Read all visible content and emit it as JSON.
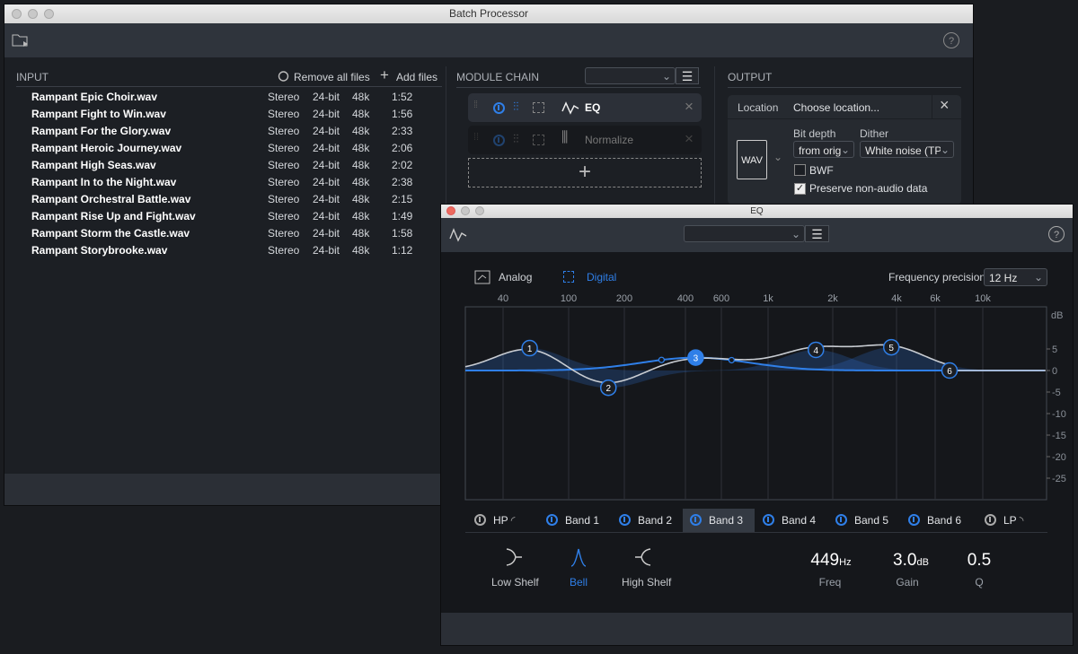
{
  "batch": {
    "title": "Batch Processor",
    "input_header": "INPUT",
    "remove_all_label": "Remove all files",
    "add_files_label": "Add files",
    "files": [
      {
        "name": "Rampant Epic Choir.wav",
        "channels": "Stereo",
        "bits": "24-bit",
        "rate": "48k",
        "duration": "1:52"
      },
      {
        "name": "Rampant Fight to Win.wav",
        "channels": "Stereo",
        "bits": "24-bit",
        "rate": "48k",
        "duration": "1:56"
      },
      {
        "name": "Rampant For the Glory.wav",
        "channels": "Stereo",
        "bits": "24-bit",
        "rate": "48k",
        "duration": "2:33"
      },
      {
        "name": "Rampant Heroic Journey.wav",
        "channels": "Stereo",
        "bits": "24-bit",
        "rate": "48k",
        "duration": "2:06"
      },
      {
        "name": "Rampant High Seas.wav",
        "channels": "Stereo",
        "bits": "24-bit",
        "rate": "48k",
        "duration": "2:02"
      },
      {
        "name": "Rampant In to the Night.wav",
        "channels": "Stereo",
        "bits": "24-bit",
        "rate": "48k",
        "duration": "2:38"
      },
      {
        "name": "Rampant Orchestral Battle.wav",
        "channels": "Stereo",
        "bits": "24-bit",
        "rate": "48k",
        "duration": "2:15"
      },
      {
        "name": "Rampant Rise Up and Fight.wav",
        "channels": "Stereo",
        "bits": "24-bit",
        "rate": "48k",
        "duration": "1:49"
      },
      {
        "name": "Rampant Storm the Castle.wav",
        "channels": "Stereo",
        "bits": "24-bit",
        "rate": "48k",
        "duration": "1:58"
      },
      {
        "name": "Rampant Storybrooke.wav",
        "channels": "Stereo",
        "bits": "24-bit",
        "rate": "48k",
        "duration": "1:12"
      }
    ],
    "module_chain_header": "MODULE CHAIN",
    "modules": [
      {
        "name": "EQ",
        "enabled": true
      },
      {
        "name": "Normalize",
        "enabled": false
      }
    ],
    "output_header": "OUTPUT",
    "location_label": "Location",
    "location_value": "Choose location...",
    "format": "WAV",
    "bit_depth_label": "Bit depth",
    "bit_depth_value": "from orig",
    "dither_label": "Dither",
    "dither_value": "White noise (TPD",
    "bwf_label": "BWF",
    "bwf_checked": false,
    "preserve_label": "Preserve non-audio data",
    "preserve_checked": true
  },
  "eq": {
    "title": "EQ",
    "analog_label": "Analog",
    "digital_label": "Digital",
    "mode": "Digital",
    "precision_label": "Frequency precision",
    "precision_value": "12 Hz",
    "tabs": [
      {
        "label": "HP",
        "enabled": false
      },
      {
        "label": "Band 1",
        "enabled": true
      },
      {
        "label": "Band 2",
        "enabled": true
      },
      {
        "label": "Band 3",
        "enabled": true,
        "selected": true
      },
      {
        "label": "Band 4",
        "enabled": true
      },
      {
        "label": "Band 5",
        "enabled": true
      },
      {
        "label": "Band 6",
        "enabled": true
      },
      {
        "label": "LP",
        "enabled": false
      }
    ],
    "shapes": [
      "Low Shelf",
      "Bell",
      "High Shelf"
    ],
    "selected_shape": "Bell",
    "freq_value": "449",
    "freq_unit": "Hz",
    "freq_label": "Freq",
    "gain_value": "3.0",
    "gain_unit": "dB",
    "gain_label": "Gain",
    "q_value": "0.5",
    "q_label": "Q",
    "accent": "#2f7fe8"
  },
  "chart_data": {
    "type": "line",
    "x_ticks": [
      "40",
      "100",
      "200",
      "400",
      "600",
      "1k",
      "2k",
      "4k",
      "6k",
      "10k"
    ],
    "y_unit": "dB",
    "y_ticks": [
      "5",
      "0",
      "-5",
      "-10",
      "-15",
      "-20",
      "-25"
    ],
    "ylim": [
      -30,
      13
    ],
    "x_scale": "log",
    "bands": [
      {
        "label": "1",
        "freq": 58,
        "gain": 5.2
      },
      {
        "label": "2",
        "freq": 164,
        "gain": -4.0
      },
      {
        "label": "3",
        "freq": 449,
        "gain": 3.0
      },
      {
        "label": "4",
        "freq": 1670,
        "gain": 4.8
      },
      {
        "label": "5",
        "freq": 3780,
        "gain": 5.4
      },
      {
        "label": "6",
        "freq": 7000,
        "gain": 0
      }
    ]
  }
}
